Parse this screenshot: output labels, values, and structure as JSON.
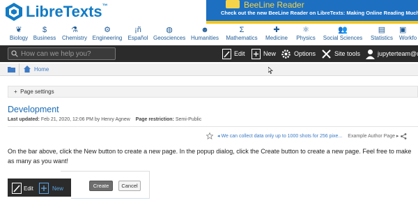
{
  "brand": {
    "name": "LibreTexts",
    "mark": "™",
    "logo_icon": "libretexts-logo-icon"
  },
  "banner": {
    "title": "BeeLine Reader",
    "subtitle": "Check out the new BeeLine Reader on LibreTexts: Making Online Reading Much Eas",
    "colors": {
      "background": "#1d6fc1",
      "title": "#f5d44a"
    }
  },
  "subjects": [
    {
      "label": "Biology",
      "icon": "leaf-icon"
    },
    {
      "label": "Business",
      "icon": "dollar-icon"
    },
    {
      "label": "Chemistry",
      "icon": "flask-icon"
    },
    {
      "label": "Engineering",
      "icon": "gears-icon"
    },
    {
      "label": "Español",
      "icon": "spanish-icon"
    },
    {
      "label": "Geosciences",
      "icon": "globe-icon"
    },
    {
      "label": "Humanities",
      "icon": "head-icon"
    },
    {
      "label": "Mathematics",
      "icon": "sigma-icon"
    },
    {
      "label": "Medicine",
      "icon": "cross-icon"
    },
    {
      "label": "Physics",
      "icon": "atom-icon"
    },
    {
      "label": "Social Sciences",
      "icon": "people-icon"
    },
    {
      "label": "Statistics",
      "icon": "chart-icon"
    },
    {
      "label": "Workfo",
      "icon": "briefcase-icon"
    }
  ],
  "toolbar": {
    "search_placeholder": "How can we help you?",
    "edit": "Edit",
    "new": "New",
    "options": "Options",
    "site_tools": "Site tools",
    "user": "jupyterteam@uc"
  },
  "breadcrumb": {
    "home": "Home"
  },
  "page_settings": "Page settings",
  "page": {
    "title": "Development",
    "last_updated_label": "Last updated:",
    "last_updated": "Feb 21, 2020, 12:06 PM by Henry Agnew",
    "restriction_label": "Page restriction:",
    "restriction": "Semi-Public",
    "notice": "◂ We can collect data only up to 1000 shots for 256 pixe...",
    "template": "Example Author Page ▸",
    "body": "On the bar above, click the New button to create a new page. In the popup dialog, click the Create button to create a new page. Feel free to make as many as you want!"
  },
  "illustration": {
    "edit": "Edit",
    "new": "New",
    "create": "Create",
    "cancel": "Cancel"
  },
  "colors": {
    "accent": "#1a6bb5",
    "toolbar": "#2b2b2b",
    "nav_text": "#1f5b96"
  }
}
